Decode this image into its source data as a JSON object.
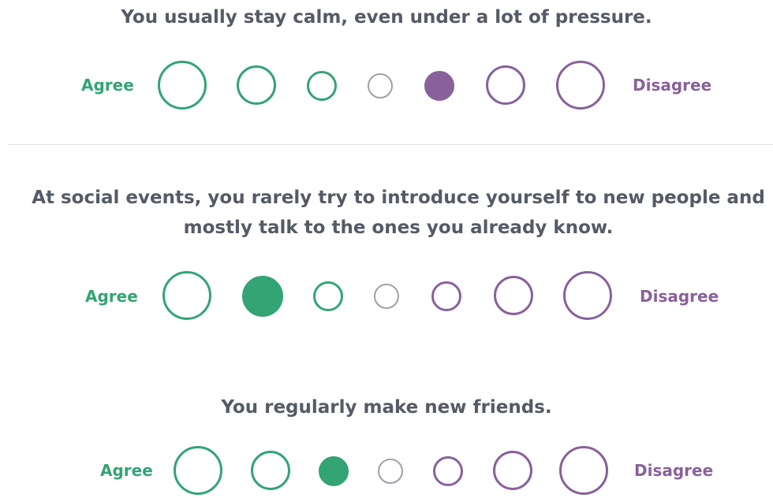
{
  "scale_labels": {
    "agree": "Agree",
    "disagree": "Disagree"
  },
  "colors": {
    "agree": "#33a474",
    "neutral": "#9ea1a8",
    "disagree": "#88619a",
    "text": "#555a66"
  },
  "questions": [
    {
      "text": "You usually stay calm, even under a lot of pressure.",
      "options": [
        "strongly-agree",
        "agree",
        "slightly-agree",
        "neutral",
        "slightly-disagree",
        "disagree",
        "strongly-disagree"
      ],
      "selected_index": 4
    },
    {
      "text": "At social events, you rarely try to introduce yourself to new people and mostly talk to the ones you already know.",
      "options": [
        "strongly-agree",
        "agree",
        "slightly-agree",
        "neutral",
        "slightly-disagree",
        "disagree",
        "strongly-disagree"
      ],
      "selected_index": 1
    },
    {
      "text": "You regularly make new friends.",
      "options": [
        "strongly-agree",
        "agree",
        "slightly-agree",
        "neutral",
        "slightly-disagree",
        "disagree",
        "strongly-disagree"
      ],
      "selected_index": 2
    }
  ]
}
